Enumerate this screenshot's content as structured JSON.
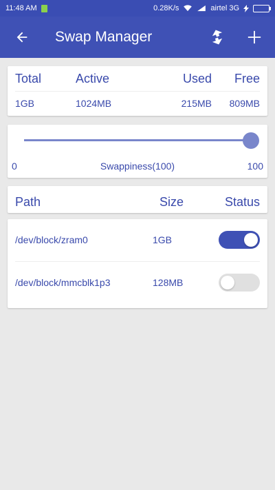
{
  "status_bar": {
    "time": "11:48 AM",
    "network_speed": "0.28K/s",
    "carrier": "airtel 3G",
    "icons": [
      "sim-icon",
      "wifi-icon",
      "signal-icon",
      "charging-icon",
      "battery-icon"
    ]
  },
  "app_bar": {
    "title": "Swap Manager",
    "back_icon": "arrow-left-icon",
    "actions": [
      "sync-icon",
      "plus-icon"
    ],
    "color": "#3f51b5"
  },
  "memory": {
    "headers": [
      "Total",
      "Active",
      "Used",
      "Free"
    ],
    "values": [
      "1GB",
      "1024MB",
      "215MB",
      "809MB"
    ]
  },
  "swappiness": {
    "min_label": "0",
    "max_label": "100",
    "label": "Swappiness(100)",
    "value": 100,
    "accent": "#7986cb"
  },
  "table": {
    "headers": {
      "path": "Path",
      "size": "Size",
      "status": "Status"
    },
    "rows": [
      {
        "path": "/dev/block/zram0",
        "size": "1GB",
        "enabled": true
      },
      {
        "path": "/dev/block/mmcblk1p3",
        "size": "128MB",
        "enabled": false
      }
    ]
  }
}
